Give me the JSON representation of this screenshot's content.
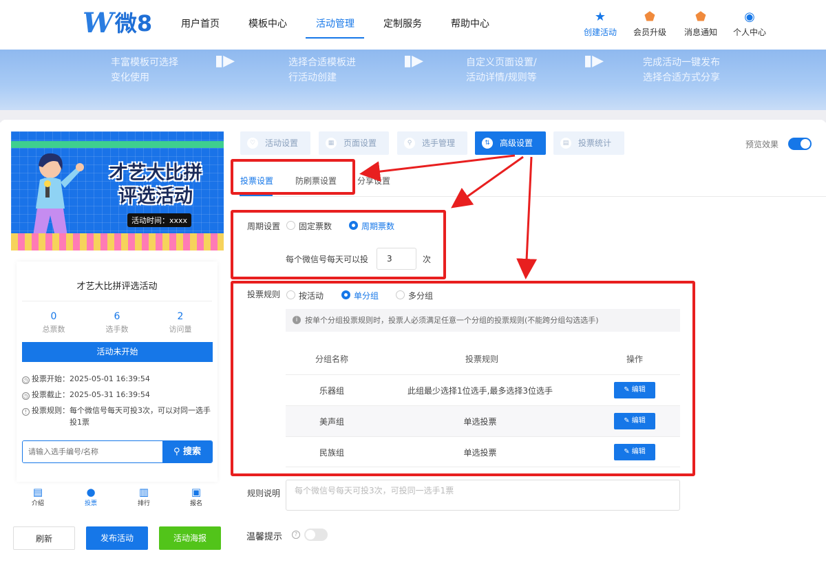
{
  "header": {
    "logo_w": "W",
    "logo_text": "微8",
    "nav": [
      "用户首页",
      "模板中心",
      "活动管理",
      "定制服务",
      "帮助中心"
    ],
    "nav_active": "活动管理",
    "icons": [
      {
        "label": "创建活动",
        "icon": "star-icon"
      },
      {
        "label": "会员升级",
        "icon": "vip-badge-icon"
      },
      {
        "label": "消息通知",
        "icon": "bell-icon"
      },
      {
        "label": "个人中心",
        "icon": "user-icon"
      }
    ]
  },
  "banner": {
    "steps": [
      {
        "line1": "丰富模板可选择",
        "line2": "变化使用"
      },
      {
        "line1": "选择合适模板进",
        "line2": "行活动创建"
      },
      {
        "line1": "自定义页面设置/",
        "line2": "活动详情/规则等"
      },
      {
        "line1": "完成活动一键发布",
        "line2": "选择合适方式分享"
      }
    ]
  },
  "preview": {
    "poster": {
      "title1": "才艺大比拼",
      "title2": "评选活动",
      "time": "活动时间：xxxx"
    },
    "title": "才艺大比拼评选活动",
    "stats": [
      {
        "value": "0",
        "label": "总票数"
      },
      {
        "value": "6",
        "label": "选手数"
      },
      {
        "value": "2",
        "label": "访问量"
      }
    ],
    "status": "活动未开始",
    "vote_start": "投票开始：2025-05-01 16:39:54",
    "vote_end": "投票截止：2025-05-31 16:39:54",
    "vote_rule_label": "投票规则：",
    "vote_rule_line1": "每个微信号每天可投3次，可以对同一选手",
    "vote_rule_line2": "投1票",
    "search_placeholder": "请输入选手编号/名称",
    "search_btn": "搜索",
    "tabbar": [
      "介绍",
      "投票",
      "排行",
      "报名"
    ],
    "tabbar_active": "投票"
  },
  "bottom_buttons": {
    "refresh": "刷新",
    "publish": "发布活动",
    "poster": "活动海报"
  },
  "tabs": [
    "活动设置",
    "页面设置",
    "选手管理",
    "高级设置",
    "投票统计"
  ],
  "tab_active": "高级设置",
  "preview_toggle": {
    "label": "预览效果",
    "on": true
  },
  "subtabs": [
    "投票设置",
    "防刷票设置",
    "分享设置"
  ],
  "subtab_active": "投票设置",
  "period": {
    "label": "周期设置",
    "options": [
      "固定票数",
      "周期票数"
    ],
    "selected": "周期票数",
    "daily_prefix": "每个微信号每天可以投",
    "daily_value": "3",
    "daily_suffix": "次"
  },
  "rules": {
    "label": "投票规则",
    "options": [
      "按活动",
      "单分组",
      "多分组"
    ],
    "selected": "单分组",
    "notice": "按单个分组投票规则时，投票人必须满足任意一个分组的投票规则(不能跨分组勾选选手)",
    "table": {
      "headers": [
        "分组名称",
        "投票规则",
        "操作"
      ],
      "rows": [
        {
          "name": "乐器组",
          "rule": "此组最少选择1位选手,最多选择3位选手",
          "action": "编辑"
        },
        {
          "name": "美声组",
          "rule": "单选投票",
          "action": "编辑"
        },
        {
          "name": "民族组",
          "rule": "单选投票",
          "action": "编辑"
        }
      ]
    }
  },
  "rule_desc": {
    "label": "规则说明",
    "placeholder": "每个微信号每天可投3次，可投同一选手1票"
  },
  "tips": {
    "label": "温馨提示",
    "on": false
  },
  "colors": {
    "primary": "#1677e8",
    "green": "#52c41a",
    "annotation": "#e81f1f"
  }
}
